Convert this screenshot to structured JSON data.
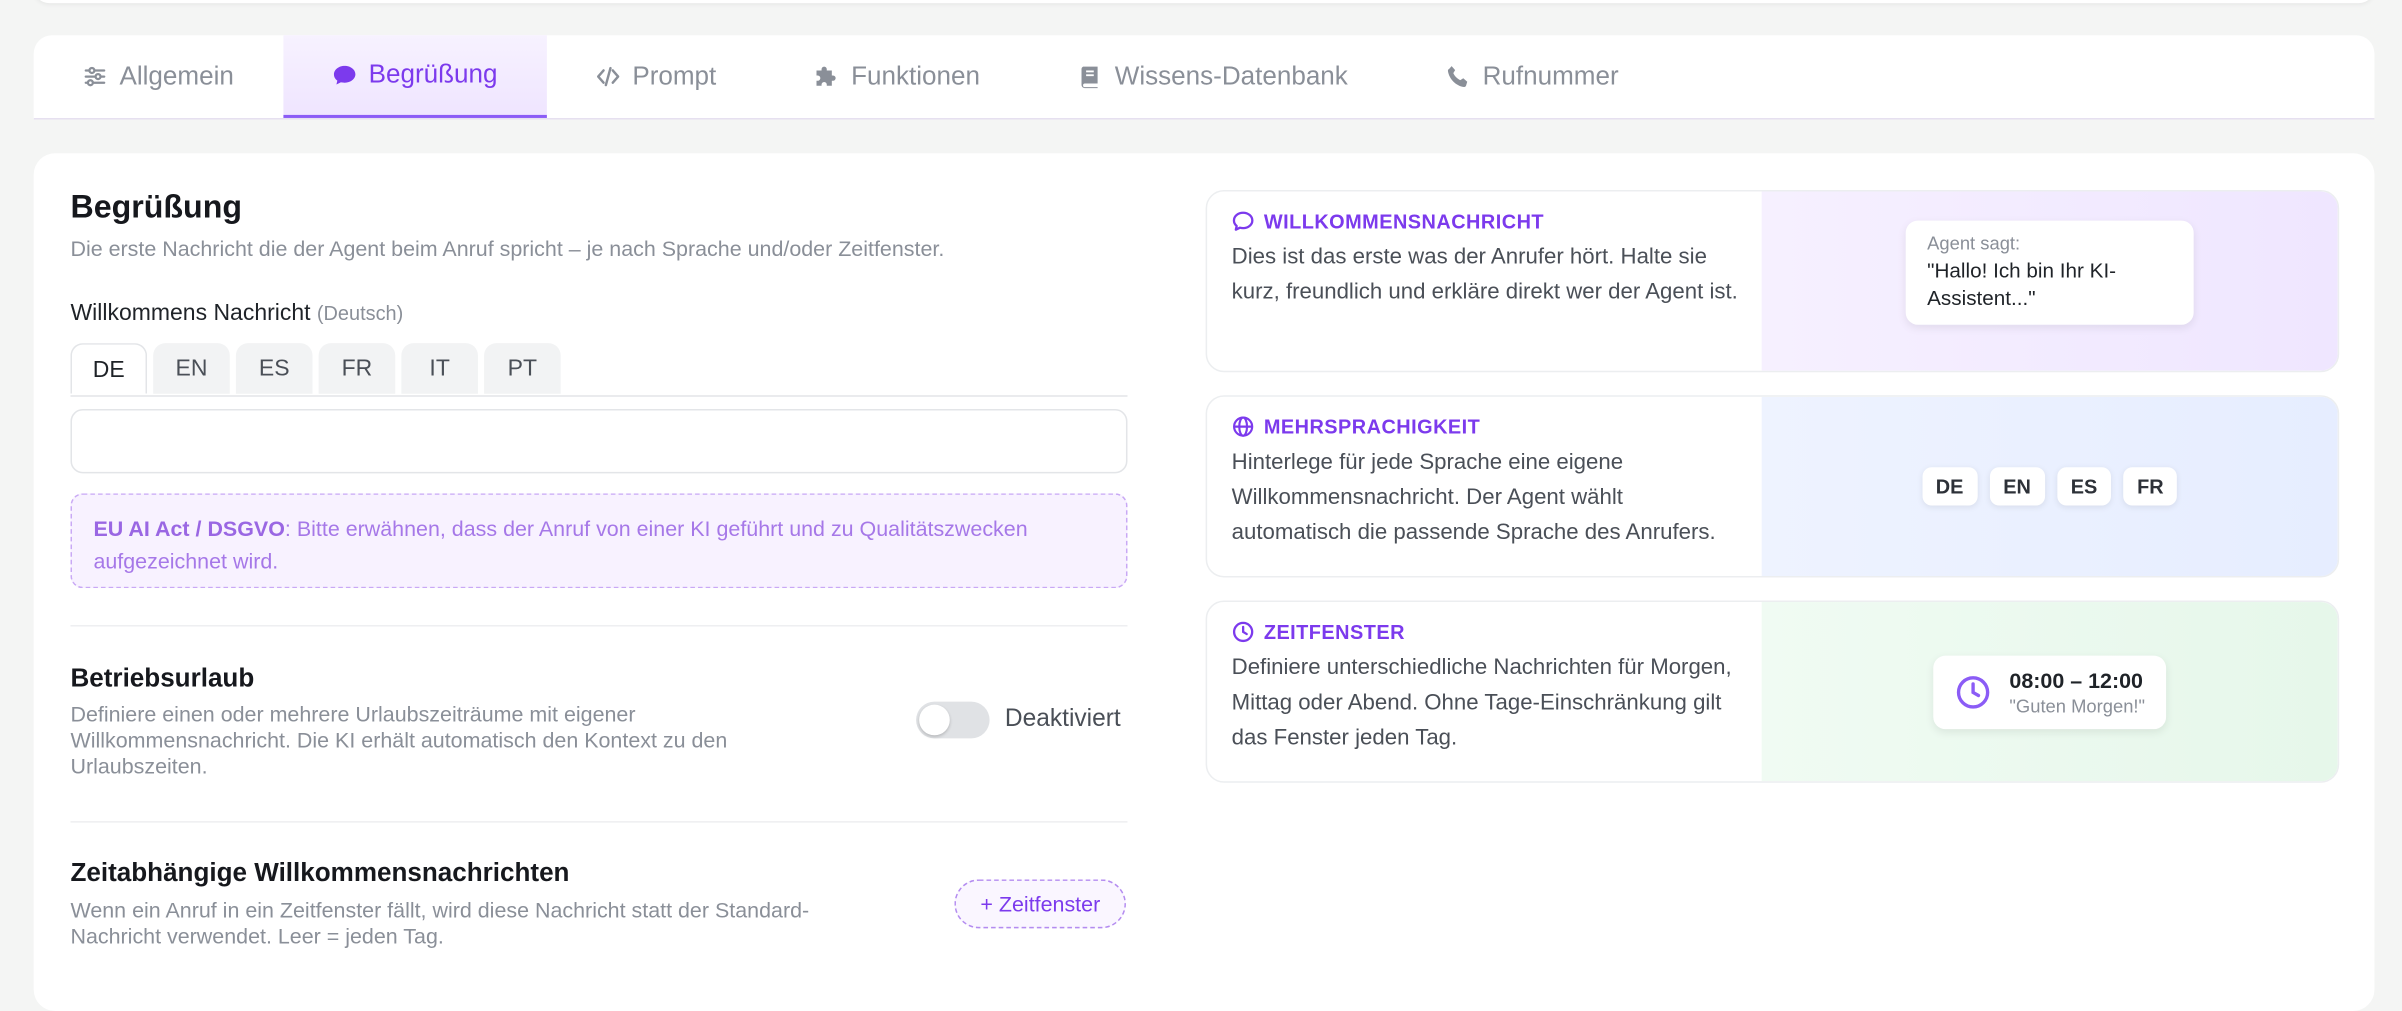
{
  "tabs": [
    {
      "label": "Allgemein",
      "icon": "sliders-icon",
      "active": false
    },
    {
      "label": "Begrüßung",
      "icon": "chat-bubble-icon",
      "active": true
    },
    {
      "label": "Prompt",
      "icon": "code-icon",
      "active": false
    },
    {
      "label": "Funktionen",
      "icon": "puzzle-icon",
      "active": false
    },
    {
      "label": "Wissens-Datenbank",
      "icon": "book-icon",
      "active": false
    },
    {
      "label": "Rufnummer",
      "icon": "phone-icon",
      "active": false
    }
  ],
  "main": {
    "title": "Begrüßung",
    "subtitle": "Die erste Nachricht die der Agent beim Anruf spricht – je nach Sprache und/oder Zeitfenster.",
    "welcome": {
      "label": "Willkommens Nachricht",
      "hint": "(Deutsch)",
      "languages": [
        "DE",
        "EN",
        "ES",
        "FR",
        "IT",
        "PT"
      ],
      "active_language": "DE",
      "value": "",
      "placeholder": ""
    },
    "notice": {
      "bold": "EU AI Act / DSGVO",
      "text": ": Bitte erwähnen, dass der Anruf von einer KI geführt und zu Qualitätszwecken aufgezeichnet wird."
    },
    "vacation": {
      "title": "Betriebsurlaub",
      "desc": "Definiere einen oder mehrere Urlaubszeiträume mit eigener Willkommensnachricht. Die KI erhält automatisch den Kontext zu den Urlaubszeiten.",
      "toggle_label": "Deaktiviert",
      "enabled": false
    },
    "time_messages": {
      "title": "Zeitabhängige Willkommensnachrichten",
      "desc": "Wenn ein Anruf in ein Zeitfenster fällt, wird diese Nachricht statt der Standard-Nachricht verwendet. Leer = jeden Tag.",
      "add_button": "+ Zeitfenster"
    }
  },
  "info_cards": {
    "welcome": {
      "heading": "WILLKOMMENSNACHRICHT",
      "body": "Dies ist das erste was der Anrufer hört. Halte sie kurz, freundlich und erkläre direkt wer der Agent ist.",
      "speaker": "Agent sagt:",
      "quote": "\"Hallo! Ich bin Ihr KI-Assistent...\""
    },
    "multilang": {
      "heading": "MEHRSPRACHIGKEIT",
      "body": "Hinterlege für jede Sprache eine eigene Willkommensnachricht. Der Agent wählt automatisch die passende Sprache des Anrufers.",
      "chips": [
        "DE",
        "EN",
        "ES",
        "FR"
      ]
    },
    "timewindow": {
      "heading": "ZEITFENSTER",
      "body": "Definiere unterschiedliche Nachrichten für Morgen, Mittag oder Abend. Ohne Tage-Einschränkung gilt das Fenster jeden Tag.",
      "range": "08:00 – 12:00",
      "example": "\"Guten Morgen!\""
    }
  },
  "colors": {
    "accent": "#7c3aed",
    "accent_light": "#f7f2ff",
    "muted": "#8a8f98"
  }
}
